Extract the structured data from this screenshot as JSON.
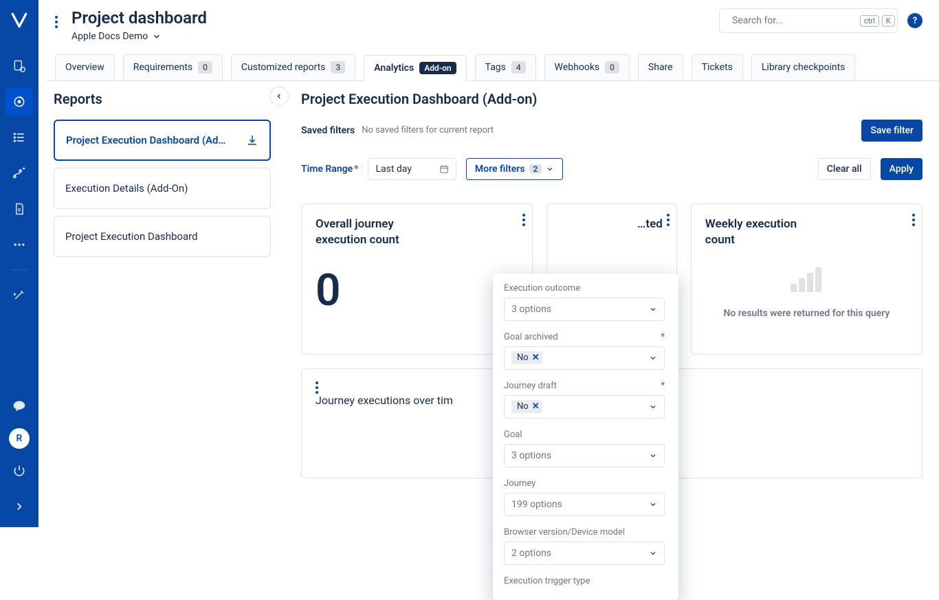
{
  "header": {
    "title": "Project dashboard",
    "breadcrumb": "Apple Docs Demo",
    "search_placeholder": "Search for...",
    "kbd1": "ctrl",
    "kbd2": "K"
  },
  "rail": {
    "avatar": "R"
  },
  "tabs": {
    "overview": "Overview",
    "requirements": "Requirements",
    "requirements_count": "0",
    "customized": "Customized reports",
    "customized_count": "3",
    "analytics": "Analytics",
    "analytics_badge": "Add-on",
    "tags": "Tags",
    "tags_count": "4",
    "webhooks": "Webhooks",
    "webhooks_count": "0",
    "share": "Share",
    "tickets": "Tickets",
    "library": "Library checkpoints"
  },
  "reports": {
    "heading": "Reports",
    "items": [
      "Project Execution Dashboard (Ad…",
      "Execution Details (Add-On)",
      "Project Execution Dashboard"
    ]
  },
  "content": {
    "heading": "Project Execution Dashboard (Add-on)",
    "saved_filters_label": "Saved filters",
    "saved_filters_text": "No saved filters for current report",
    "save_filter_btn": "Save filter",
    "time_range_label": "Time Range",
    "time_range_value": "Last day",
    "more_filters": "More filters",
    "more_filters_count": "2",
    "clear_all": "Clear all",
    "apply": "Apply",
    "card1_title": "Overall journey execution count",
    "card1_value": "0",
    "card2_title_partial": "…ted",
    "card3_title": "Weekly execution count",
    "card3_noresults": "No results were returned for this query",
    "card4_title": "Journey executions over tim"
  },
  "dropdown": {
    "groups": [
      {
        "label": "Execution outcome",
        "value": "3 options",
        "required": false,
        "tag": ""
      },
      {
        "label": "Goal archived",
        "value": "",
        "required": true,
        "tag": "No"
      },
      {
        "label": "Journey draft",
        "value": "",
        "required": true,
        "tag": "No"
      },
      {
        "label": "Goal",
        "value": "3 options",
        "required": false,
        "tag": ""
      },
      {
        "label": "Journey",
        "value": "199 options",
        "required": false,
        "tag": ""
      },
      {
        "label": "Browser version/Device model",
        "value": "2 options",
        "required": false,
        "tag": ""
      },
      {
        "label": "Execution trigger type",
        "value": "",
        "required": false,
        "tag": ""
      }
    ]
  }
}
